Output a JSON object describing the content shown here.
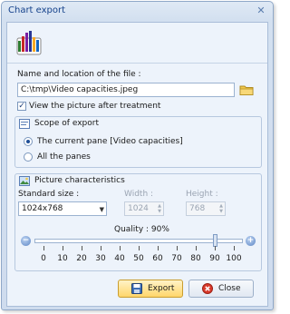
{
  "window": {
    "title": "Chart export",
    "close_symbol": "✕"
  },
  "file": {
    "label": "Name and location of the file :",
    "path": "C:\\tmp\\Video capacities.jpeg",
    "view_after_label": "View the picture after treatment",
    "view_after_checked": true
  },
  "scope": {
    "title": "Scope of export",
    "options": [
      {
        "label": "The current pane [Video capacities]",
        "selected": true
      },
      {
        "label": "All the panes",
        "selected": false
      }
    ]
  },
  "picture": {
    "title": "Picture characteristics",
    "standard_size_label": "Standard size :",
    "standard_size_value": "1024x768",
    "width_label": "Width :",
    "width_value": "1024",
    "height_label": "Height :",
    "height_value": "768",
    "quality_label": "Quality : 90%",
    "quality_value": 90,
    "ticks": [
      "0",
      "10",
      "20",
      "30",
      "40",
      "50",
      "60",
      "70",
      "80",
      "90",
      "100"
    ]
  },
  "buttons": {
    "export": "Export",
    "close": "Close"
  },
  "colors": {
    "accent": "#15428b",
    "primary_button": "#ffd66b",
    "border": "#9bb2d0"
  }
}
